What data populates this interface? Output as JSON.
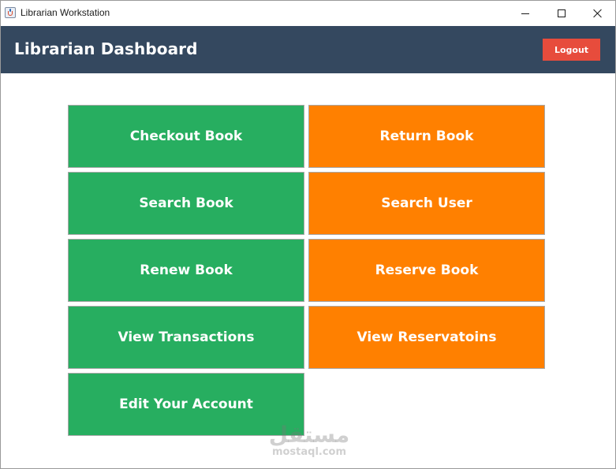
{
  "window": {
    "title": "Librarian Workstation"
  },
  "header": {
    "title": "Librarian Dashboard",
    "logout_label": "Logout"
  },
  "colors": {
    "header_bg": "#34485f",
    "logout_bg": "#e74c3c",
    "tile_green": "#27ae60",
    "tile_orange": "#ff8000"
  },
  "actions": {
    "checkout_book": "Checkout Book",
    "return_book": "Return Book",
    "search_book": "Search Book",
    "search_user": "Search User",
    "renew_book": "Renew Book",
    "reserve_book": "Reserve Book",
    "view_transactions": "View Transactions",
    "view_reservations": "View Reservatoins",
    "edit_account": "Edit Your Account"
  },
  "watermark": {
    "arabic": "مستقل",
    "latin": "mostaql.com"
  }
}
